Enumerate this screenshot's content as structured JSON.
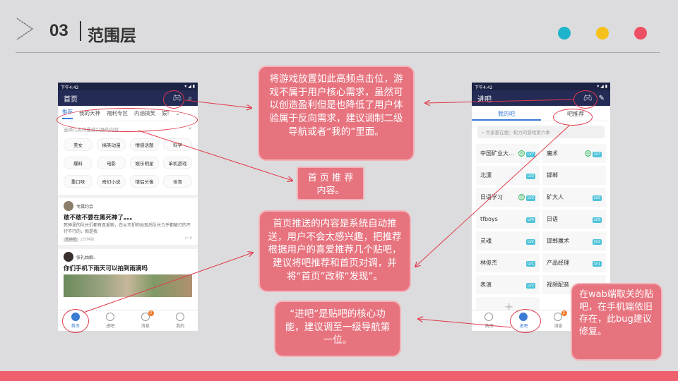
{
  "header": {
    "section_number": "03",
    "section_title": "范围层",
    "dot_colors": [
      "#1fb3cc",
      "#f5c11a",
      "#ef4f63"
    ]
  },
  "left_phone": {
    "status_time": "下午4:42",
    "status_right": "▾ ◢ ▮",
    "title": "首页",
    "tabs": [
      "推荐",
      "我的大神",
      "福利专区",
      "内涵搞笑",
      "娱!"
    ],
    "hint": "选择几类你最感兴趣的内容",
    "hint_close": "×",
    "tags": [
      "美女",
      "搞笑动漫",
      "情感话题",
      "科学",
      "爆料",
      "电影",
      "娱乐明星",
      "单机游戏",
      "重口味",
      "奇幻小说",
      "情侣头像",
      "体育"
    ],
    "posts": [
      {
        "author": "专属约会",
        "title": "敢不敢不要在黑死神了。。。",
        "body": "死神里的队长们都有真爱粉，白从灭却师出现后队长几乎都被打的不行不行的，但是我",
        "chip": "死神吧",
        "time": "2分钟前",
        "comments": "5"
      },
      {
        "author": "张礼姑娘、",
        "title": "你们手机下雨天可以拍到雨滴吗",
        "body": "",
        "chip": "",
        "time": "",
        "comments": ""
      }
    ],
    "bottom_nav": [
      "首页",
      "进吧",
      "消息",
      "我的"
    ],
    "badge": "2"
  },
  "right_phone": {
    "status_time": "下午4:42",
    "status_right": "▾ ◢ ▮",
    "title": "进吧",
    "tabs": [
      "我的吧",
      "吧推荐"
    ],
    "search_placeholder": "大家都在搜：权力的游戏第六季",
    "bars": [
      {
        "name": "中国矿业大...",
        "lv": "LV7",
        "signed": true
      },
      {
        "name": "魔术",
        "lv": "LV7",
        "signed": true
      },
      {
        "name": "北漂",
        "lv": "LV2",
        "signed": false
      },
      {
        "name": "邯郸",
        "lv": "",
        "signed": false
      },
      {
        "name": "日语学习",
        "lv": "LV2",
        "signed": true
      },
      {
        "name": "矿大人",
        "lv": "LV2",
        "signed": false
      },
      {
        "name": "tfboys",
        "lv": "LV4",
        "signed": false
      },
      {
        "name": "日语",
        "lv": "LV5",
        "signed": false
      },
      {
        "name": "灵魂",
        "lv": "LV2",
        "signed": false
      },
      {
        "name": "邯郸魔术",
        "lv": "LV2",
        "signed": false
      },
      {
        "name": "林俊杰",
        "lv": "LV1",
        "signed": false
      },
      {
        "name": "产品经理",
        "lv": "LV1",
        "signed": false
      },
      {
        "name": "表演",
        "lv": "LV2",
        "signed": false
      },
      {
        "name": "视频配音",
        "lv": "LV1",
        "signed": false
      }
    ],
    "add": "+",
    "bottom_nav": [
      "首页",
      "进吧",
      "消息",
      "我的"
    ],
    "badge": "2"
  },
  "callouts": {
    "game": "将游戏放置如此高频点击位，游戏不属于用户核心需求，虽然可以创造盈利但是也降低了用户体验属于反向需求，建议调制二级导航或者“我的”里面。",
    "recommend_tabs": "首 页 推 荐内容。",
    "push": "首页推送的内容是系统自动推送，用户不会太感兴趣，把推荐根据用户的喜爱推荐几个贴吧，建议将吧推荐和首页对调，并将“首页”改称“发现”。",
    "jinba": "“进吧”是贴吧的核心功能，建议调至一级导航第一位。",
    "bug": "在wab端取关的贴吧，在手机端依旧存在，此bug建议修复。"
  }
}
